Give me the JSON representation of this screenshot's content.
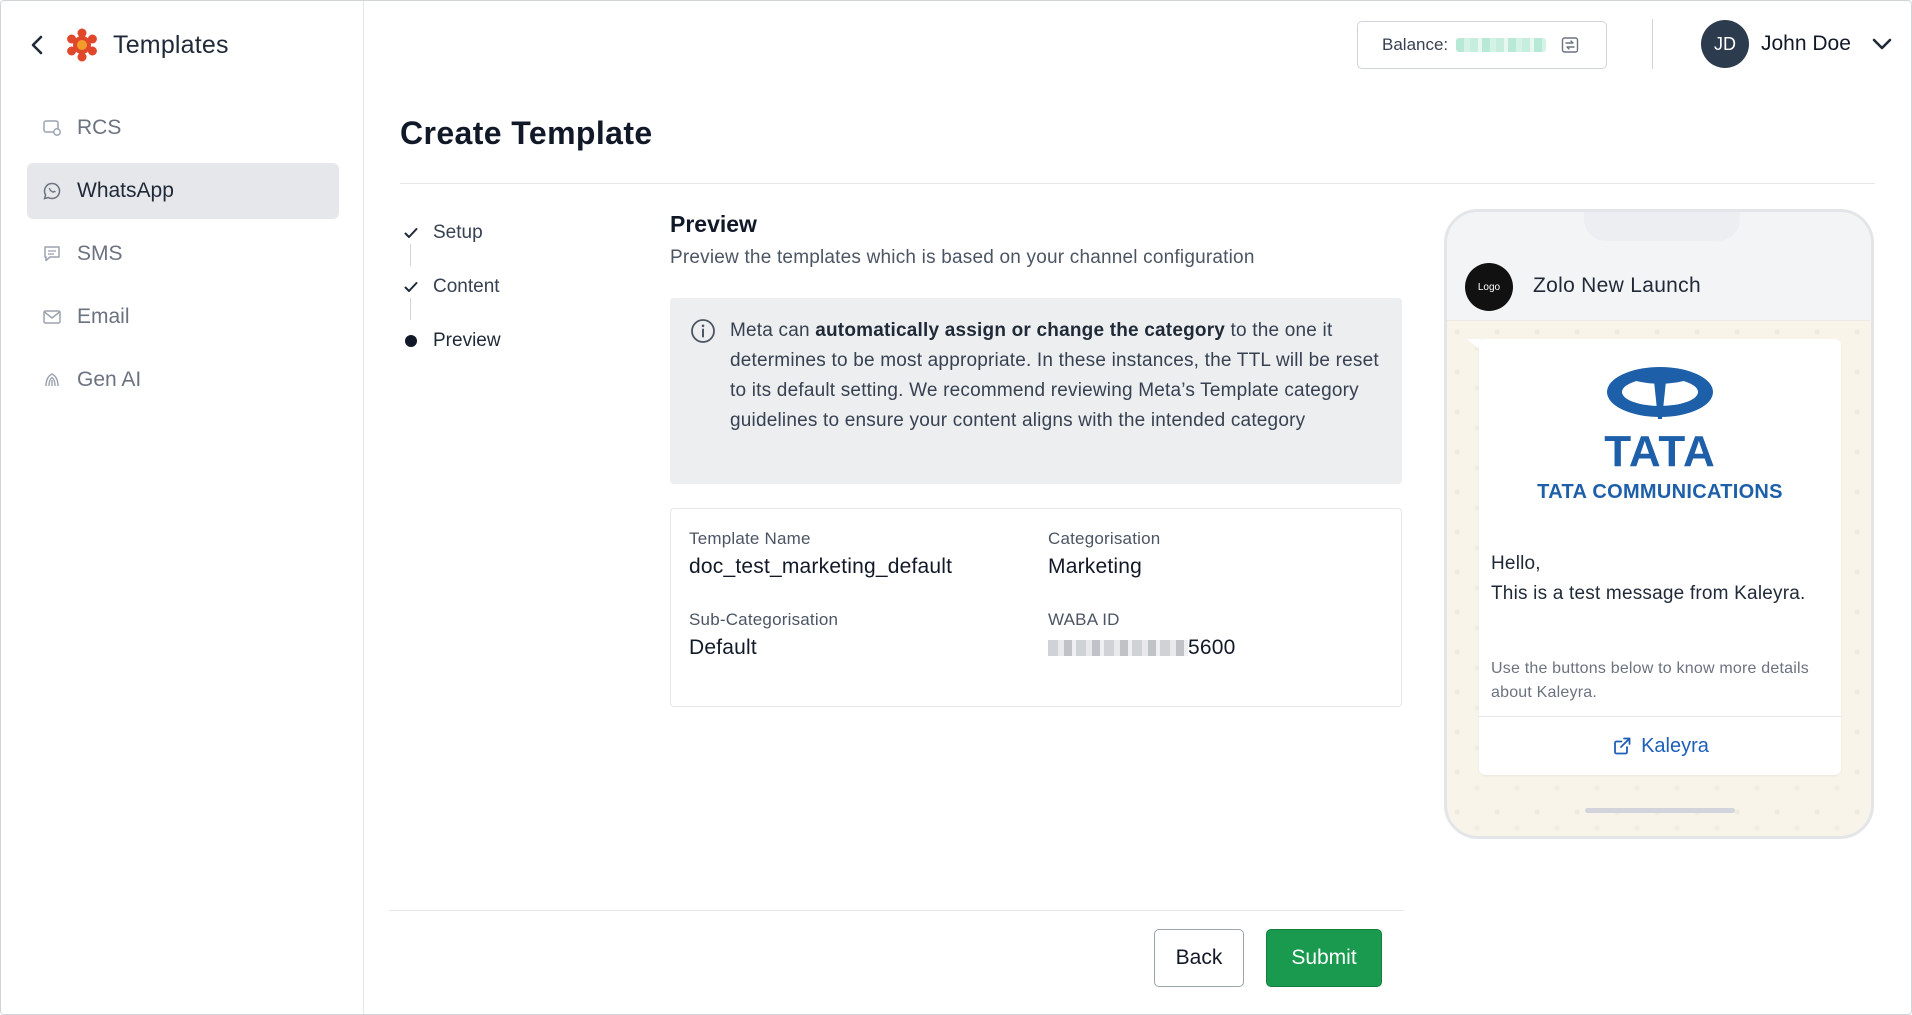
{
  "sidebar": {
    "title": "Templates",
    "items": [
      {
        "label": "RCS",
        "icon": "rcs-icon",
        "active": false
      },
      {
        "label": "WhatsApp",
        "icon": "whatsapp-icon",
        "active": true
      },
      {
        "label": "SMS",
        "icon": "sms-icon",
        "active": false
      },
      {
        "label": "Email",
        "icon": "email-icon",
        "active": false
      },
      {
        "label": "Gen AI",
        "icon": "gen-ai-icon",
        "active": false
      }
    ]
  },
  "topbar": {
    "balance_label": "Balance:",
    "user_initials": "JD",
    "user_name": "John Doe"
  },
  "page": {
    "title": "Create Template"
  },
  "stepper": {
    "steps": [
      {
        "label": "Setup",
        "state": "done"
      },
      {
        "label": "Content",
        "state": "done"
      },
      {
        "label": "Preview",
        "state": "current"
      }
    ]
  },
  "preview": {
    "title": "Preview",
    "subtitle": "Preview the templates which is based on your channel configuration",
    "info": {
      "prefix": "Meta can ",
      "bold": "automatically assign or change the category",
      "suffix": " to the one it determines to be most appropriate. In these instances, the TTL will be reset to its default setting. We recommend reviewing Meta’s Template category guidelines to ensure your content aligns with the intended category"
    },
    "details": {
      "template_name_label": "Template Name",
      "template_name_value": "doc_test_marketing_default",
      "categorisation_label": "Categorisation",
      "categorisation_value": "Marketing",
      "sub_categorisation_label": "Sub-Categorisation",
      "sub_categorisation_value": "Default",
      "waba_id_label": "WABA ID",
      "waba_id_suffix": "5600"
    }
  },
  "actions": {
    "back_label": "Back",
    "submit_label": "Submit"
  },
  "phone": {
    "logo_text": "Logo",
    "chat_name": "Zolo New Launch",
    "media": {
      "brand_word": "TATA",
      "brand_sub": "TATA COMMUNICATIONS"
    },
    "body": "Hello,\nThis is a test message from Kaleyra.",
    "footer": "Use the buttons below to know more details about Kaleyra.",
    "cta_label": "Kaleyra"
  },
  "colors": {
    "accent_green": "#1a9a4f",
    "avatar_bg": "#2d3b4e",
    "tata_blue": "#1d5fa8",
    "brand_red": "#e0472b",
    "brand_orange": "#f39c2b"
  }
}
